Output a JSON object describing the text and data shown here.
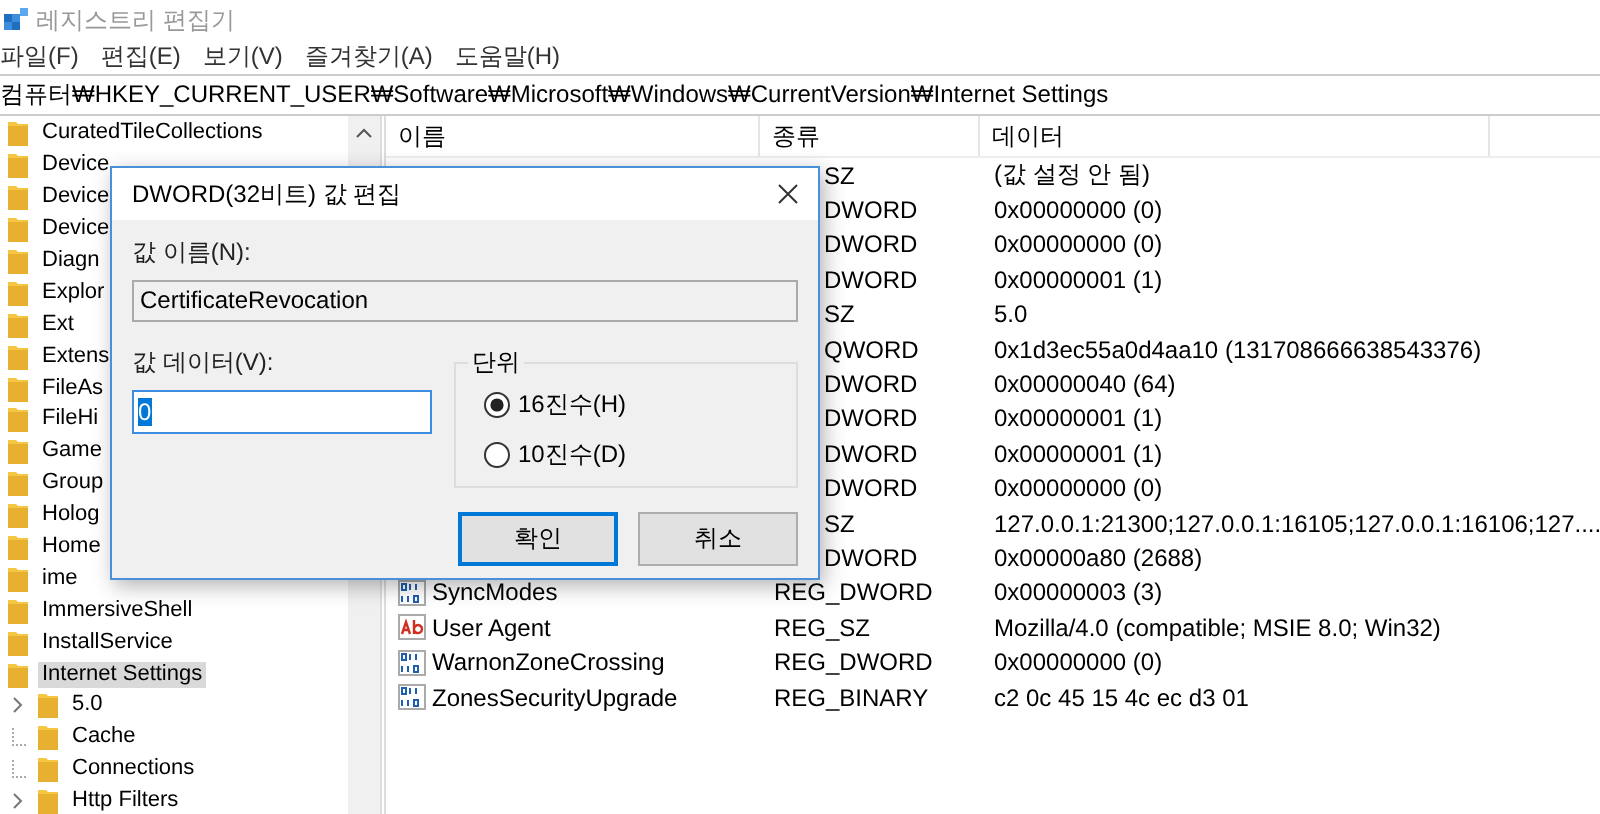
{
  "window": {
    "title": "레지스트리 편집기"
  },
  "menu": [
    "파일(F)",
    "편집(E)",
    "보기(V)",
    "즐겨찾기(A)",
    "도움말(H)"
  ],
  "address": "컴퓨터₩HKEY_CURRENT_USER₩Software₩Microsoft₩Windows₩CurrentVersion₩Internet Settings",
  "tree": {
    "items": [
      {
        "label": "CuratedTileCollections",
        "selected": false
      },
      {
        "label": "Device",
        "selected": false
      },
      {
        "label": "Device",
        "selected": false
      },
      {
        "label": "Device",
        "selected": false
      },
      {
        "label": "Diagn",
        "selected": false
      },
      {
        "label": "Explor",
        "selected": false
      },
      {
        "label": "Ext",
        "selected": false
      },
      {
        "label": "Extens",
        "selected": false
      },
      {
        "label": "FileAs",
        "selected": false
      },
      {
        "label": "FileHi",
        "selected": false
      },
      {
        "label": "Game",
        "selected": false
      },
      {
        "label": "Group",
        "selected": false
      },
      {
        "label": "Holog",
        "selected": false
      },
      {
        "label": "Home",
        "selected": false
      },
      {
        "label": "ime",
        "selected": false
      },
      {
        "label": "ImmersiveShell",
        "selected": false
      },
      {
        "label": "InstallService",
        "selected": false
      },
      {
        "label": "Internet Settings",
        "selected": true,
        "children": [
          {
            "label": "5.0",
            "selected": false,
            "expandable": true
          },
          {
            "label": "Cache",
            "selected": false,
            "expandable": false
          },
          {
            "label": "Connections",
            "selected": false,
            "expandable": false
          },
          {
            "label": "Http Filters",
            "selected": false,
            "expandable": true
          }
        ]
      }
    ]
  },
  "values": {
    "columns": [
      "이름",
      "종류",
      "데이터"
    ],
    "rows": [
      {
        "type": "SZ",
        "data": "(값 설정 안 됨)"
      },
      {
        "type": "DWORD",
        "data": "0x00000000 (0)"
      },
      {
        "type": "DWORD",
        "data": "0x00000000 (0)"
      },
      {
        "type": "DWORD",
        "data": "0x00000001 (1)"
      },
      {
        "type": "SZ",
        "data": "5.0"
      },
      {
        "type": "QWORD",
        "data": "0x1d3ec55a0d4aa10 (131708666638543376)"
      },
      {
        "type": "DWORD",
        "data": "0x00000040 (64)"
      },
      {
        "type": "DWORD",
        "data": "0x00000001 (1)"
      },
      {
        "type": "DWORD",
        "data": "0x00000001 (1)"
      },
      {
        "type": "DWORD",
        "data": "0x00000000 (0)"
      },
      {
        "type": "SZ",
        "data": "127.0.0.1:21300;127.0.0.1:16105;127.0.0.1:16106;127...."
      },
      {
        "type": "DWORD",
        "data": "0x00000a80 (2688)"
      },
      {
        "kind": "binary",
        "name": "SyncModes",
        "type": "REG_DWORD",
        "data": "0x00000003 (3)"
      },
      {
        "kind": "string",
        "name": "User Agent",
        "type": "REG_SZ",
        "data": "Mozilla/4.0 (compatible; MSIE 8.0; Win32)"
      },
      {
        "kind": "binary",
        "name": "WarnonZoneCrossing",
        "type": "REG_DWORD",
        "data": "0x00000000 (0)"
      },
      {
        "kind": "binary",
        "name": "ZonesSecurityUpgrade",
        "type": "REG_BINARY",
        "data": "c2 0c 45 15 4c ec d3 01"
      }
    ]
  },
  "dialog": {
    "title": "DWORD(32비트) 값 편집",
    "name_label": "값 이름(N):",
    "name_value": "CertificateRevocation",
    "data_label": "값 데이터(V):",
    "data_value": "0",
    "data_selected": true,
    "base": {
      "title": "단위",
      "options": [
        {
          "label": "16진수(H)",
          "selected": true
        },
        {
          "label": "10진수(D)",
          "selected": false
        }
      ]
    },
    "buttons": [
      {
        "label": "확인",
        "default": true
      },
      {
        "label": "취소",
        "default": false
      }
    ]
  }
}
